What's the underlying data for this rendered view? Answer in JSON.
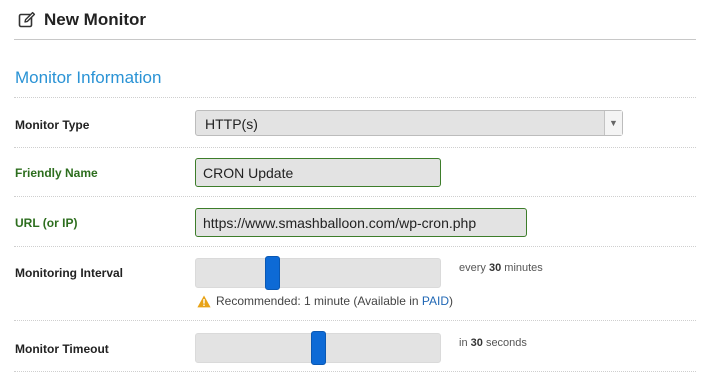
{
  "header": {
    "title": "New Monitor"
  },
  "section": {
    "title": "Monitor Information"
  },
  "monitor_type": {
    "label": "Monitor Type",
    "value": "HTTP(s)"
  },
  "friendly_name": {
    "label": "Friendly Name",
    "value": "CRON Update"
  },
  "url": {
    "label": "URL (or IP)",
    "value": "https://www.smashballoon.com/wp-cron.php"
  },
  "interval": {
    "label": "Monitoring Interval",
    "hint_prefix": "every",
    "hint_value": "30",
    "hint_suffix": "minutes",
    "slider_fraction": 0.3,
    "recommend_text": "Recommended: 1 minute (Available in",
    "recommend_link": "PAID",
    "recommend_close": ")"
  },
  "timeout": {
    "label": "Monitor Timeout",
    "hint_prefix": "in",
    "hint_value": "30",
    "hint_suffix": "seconds",
    "slider_fraction": 0.5
  },
  "colors": {
    "accent": "#2a93d5",
    "valid_label": "#2d6e1e",
    "slider": "#0d6ad6",
    "warning": "#e8a317"
  }
}
